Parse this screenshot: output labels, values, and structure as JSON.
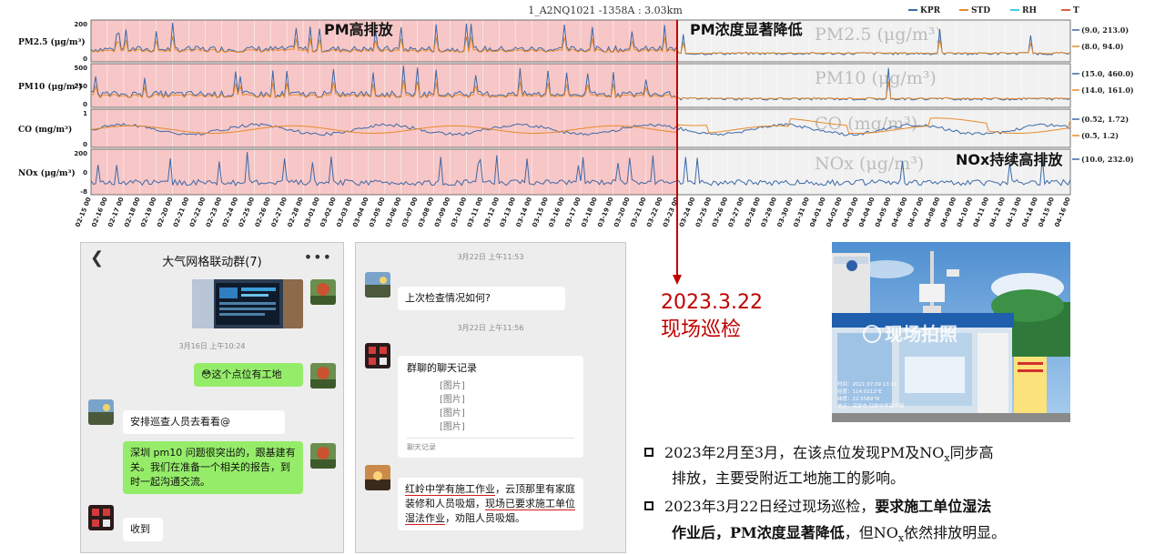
{
  "chart": {
    "title": "1_A2NQ1021 -1358A : 3.03km",
    "legend": [
      {
        "label": "KPR",
        "color": "#3c69a8"
      },
      {
        "label": "STD",
        "color": "#e88a2a"
      },
      {
        "label": "RH",
        "color": "#3fd0e6"
      },
      {
        "label": "T",
        "color": "#d9643c"
      }
    ],
    "annotations": {
      "pm_high": "PM高排放",
      "pm_drop": "PM浓度显著降低",
      "nox_high": "NOx持续高排放"
    },
    "panels": [
      {
        "ylabel": "PM2.5 (μg/m³)",
        "yticks": [
          "200",
          "0"
        ],
        "watermark": "PM2.5 (μg/m³)",
        "stats": [
          "(9.0, 213.0)",
          "(8.0, 94.0)"
        ]
      },
      {
        "ylabel": "PM10 (μg/m³)",
        "yticks": [
          "500",
          "250",
          "0"
        ],
        "watermark": "PM10 (μg/m³)",
        "stats": [
          "(15.0, 460.0)",
          "(14.0, 161.0)"
        ]
      },
      {
        "ylabel": "CO (mg/m³)",
        "yticks": [
          "1",
          "0"
        ],
        "watermark": "CO (mg/m³)",
        "stats": [
          "(0.52, 1.72)",
          "(0.5, 1.2)"
        ]
      },
      {
        "ylabel": "NOx (μg/m³)",
        "yticks": [
          "200",
          "0",
          "-8"
        ],
        "watermark": "NOx (μg/m³)",
        "stats": [
          "(10.0, 232.0)"
        ]
      }
    ],
    "xticks": [
      "02-15 00",
      "02-16 00",
      "02-17 00",
      "02-18 00",
      "02-19 00",
      "02-20 00",
      "02-21 00",
      "02-22 00",
      "02-23 00",
      "02-24 00",
      "02-25 00",
      "02-26 00",
      "02-27 00",
      "02-28 00",
      "03-01 00",
      "03-02 00",
      "03-03 00",
      "03-04 00",
      "03-05 00",
      "03-06 00",
      "03-07 00",
      "03-08 00",
      "03-09 00",
      "03-10 00",
      "03-11 00",
      "03-12 00",
      "03-13 00",
      "03-14 00",
      "03-15 00",
      "03-16 00",
      "03-17 00",
      "03-18 00",
      "03-19 00",
      "03-20 00",
      "03-21 00",
      "03-22 00",
      "03-23 00",
      "03-24 00",
      "03-25 00",
      "03-26 00",
      "03-27 00",
      "03-28 00",
      "03-29 00",
      "03-30 00",
      "03-31 00",
      "04-01 00",
      "04-02 00",
      "04-03 00",
      "04-04 00",
      "04-05 00",
      "04-06 00",
      "04-07 00",
      "04-08 00",
      "04-09 00",
      "04-10 00",
      "04-11 00",
      "04-12 00",
      "04-13 00",
      "04-14 00",
      "04-15 00",
      "04-16 00"
    ],
    "colors": {
      "highlight": "#f7c6c6",
      "background": "#f1f1f1",
      "kpr": "#3c69a8",
      "std": "#e88a2a",
      "marker": "#c00000"
    }
  },
  "date_annotation": {
    "date": "2023.3.22",
    "label": "现场巡检"
  },
  "chat1": {
    "title": "大气网格联动群(7)",
    "messages": [
      {
        "time": "3月16日 上午10:24"
      },
      {
        "text": "😳这个点位有工地",
        "side": "right"
      },
      {
        "text": "安排巡查人员去看看@",
        "side": "left"
      },
      {
        "text": "深圳 pm10 问题很突出的，跟基建有关。我们在准备一个相关的报告，到时一起沟通交流。",
        "side": "right"
      },
      {
        "text": "收到",
        "side": "left"
      }
    ]
  },
  "chat2": {
    "time1": "3月22日 上午11:53",
    "msg1": "上次检查情况如何?",
    "time2": "3月22日 上午11:56",
    "card_title": "群聊的聊天记录",
    "card_items": [
      "[图片]",
      "[图片]",
      "[图片]",
      "[图片]"
    ],
    "card_footer": "聊天记录",
    "reply": {
      "p1": "红岭中学有施工作业",
      "p2": "，云顶那里有家庭装修和人员吸烟，",
      "p3": "现场已要求施工单位湿法作业",
      "p4": "，劝阻人员吸烟。"
    }
  },
  "photo": {
    "watermark": "现场拍照",
    "meta": [
      "时间：2021.07.09 13:12",
      "经度：114.0112°E",
      "纬度：22.5589°N",
      "地点：深圳市·红岭中学高中部"
    ]
  },
  "bullets": [
    {
      "l1": "2023年2月至3月，在该点位发现PM及NO",
      "sub": "x",
      "l1b": "同步高",
      "l2": "排放，主要受附近工地施工的影响。"
    },
    {
      "l1": "2023年3月22日经过现场巡检，",
      "b1": "要求施工单位湿法",
      "l2b": "作业后，PM浓度显著降低",
      "l2": "，但NO",
      "sub": "x",
      "l2c": "依然排放明显。"
    }
  ]
}
